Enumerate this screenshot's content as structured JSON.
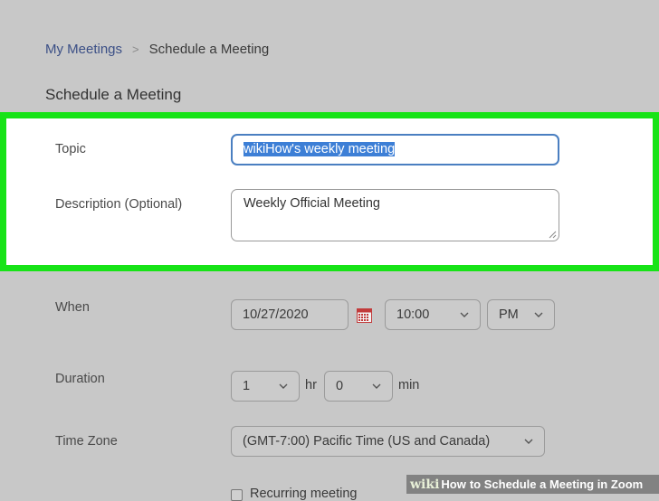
{
  "breadcrumb": {
    "parent": "My Meetings",
    "separator": ">",
    "current": "Schedule a Meeting"
  },
  "page_title": "Schedule a Meeting",
  "form": {
    "topic": {
      "label": "Topic",
      "value": "wikiHow's weekly meeting"
    },
    "description": {
      "label": "Description (Optional)",
      "value": "Weekly Official Meeting"
    },
    "when": {
      "label": "When",
      "date": "10/27/2020",
      "time": "10:00",
      "ampm": "PM"
    },
    "duration": {
      "label": "Duration",
      "hours": "1",
      "hours_unit": "hr",
      "minutes": "0",
      "minutes_unit": "min"
    },
    "timezone": {
      "label": "Time Zone",
      "value": "(GMT-7:00) Pacific Time (US and Canada)"
    },
    "recurring": {
      "label": "Recurring meeting",
      "checked": false
    }
  },
  "watermark": {
    "brand": "wiki",
    "how": "How",
    "text": "to Schedule a Meeting in Zoom"
  },
  "colors": {
    "highlight": "#17e317",
    "link": "#3b4f86",
    "selection": "#3d7fd6",
    "page_background": "#c8c8c8"
  },
  "icons": {
    "calendar": "calendar-icon",
    "dropdown": "chevron-down-icon"
  }
}
